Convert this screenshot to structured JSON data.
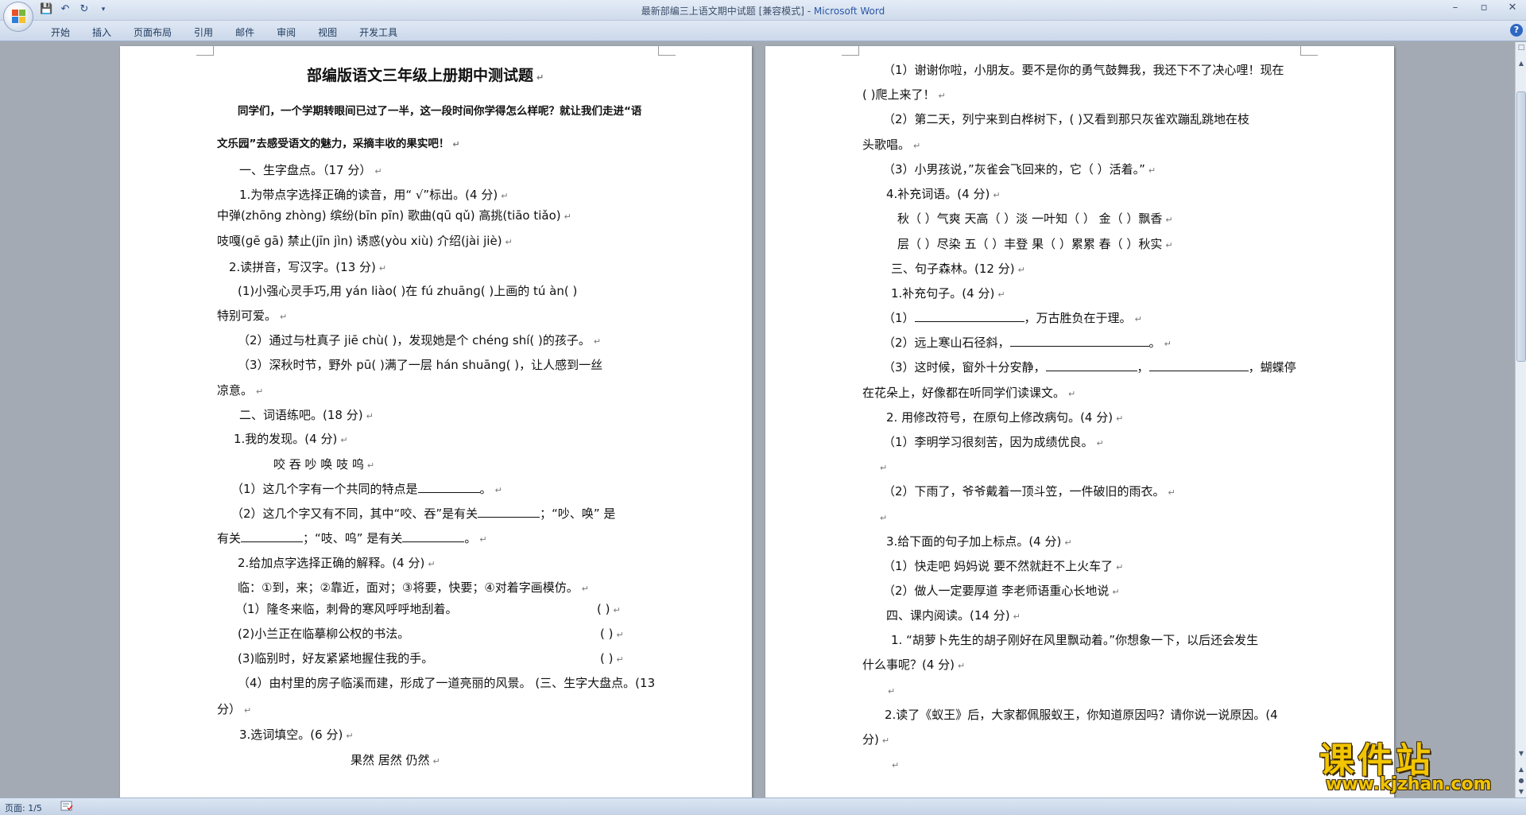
{
  "window": {
    "title": "最新部编三上语文期中试题 [兼容模式] - ",
    "app_name": "Microsoft Word",
    "controls": [
      "–",
      "▫",
      "✕"
    ]
  },
  "quick_access": [
    "save-icon",
    "undo-icon",
    "redo-icon",
    "customize-icon"
  ],
  "ribbon": {
    "tabs": [
      "开始",
      "插入",
      "页面布局",
      "引用",
      "邮件",
      "审阅",
      "视图",
      "开发工具"
    ]
  },
  "left_page": {
    "title": "部编版语文三年级上册期中测试题",
    "intro_1": "同学们，一个学期转眼间已过了一半，这一段时间你学得怎么样呢？就让我们走进“语",
    "intro_2": "文乐园”去感受语文的魅力，采摘丰收的果实吧！",
    "s1": "一、生字盘点。（17 分）",
    "q1": "1.为带点字选择正确的读音，用“ √”标出。(4 分)",
    "q1_row1": "中弹(zhōnɡ zhònɡ) 缤纷(bīn   pīn)  歌曲(qū   qǔ)    高挑(tiāo    tiǎo)",
    "q1_row2": "吱嘎(ɡē          ɡā)  禁止(jīn     jìn)  诱惑(yòu   xiù)  介绍(jài          jiè)",
    "q2": "2.读拼音，写汉字。(13 分)",
    "q2_1a": "(1)小强心灵手巧,用 yán   liào(      )在 fú  zhuānɡ(      )上画的 tú    àn(      )",
    "q2_1b": "特别可爱。",
    "q2_2": "（2）通过与杜真子 jiē    chù(        )，发现她是个 chénɡ    shí(        )的孩子。",
    "q2_3a": "（3）深秋时节，野外 pū(        )满了一层 hán    shuānɡ(        )，让人感到一丝",
    "q2_3b": "凉意。",
    "s2": "二、词语练吧。(18 分)",
    "w1": "1.我的发现。(4 分)",
    "w1_chars": "咬   吞   吵   唤   吱   呜",
    "w1_a": "（1）这几个字有一个共同的特点是",
    "w1_b1": "（2）这几个字又有不同，其中“咬、吞”是有关",
    "w1_b2": "；“吵、唤”  是",
    "w1_c1": "有关",
    "w1_c2": "；“吱、呜”  是有关",
    "w2": "2.给加点字选择正确的解释。(4 分)",
    "w2_def": "临：①到，来；②靠近，面对；③将要，快要；④对着字画模仿。",
    "w2_1": "（1）隆冬来临，刺骨的寒风呼呼地刮着。",
    "w2_2": "(2)小兰正在临摹柳公权的书法。",
    "w2_3": "(3)临别时，好友紧紧地握住我的手。",
    "w2_4a": "（4）由村里的房子临溪而建，形成了一道亮丽的风景。   (三、生字大盘点。(13",
    "w2_4b": "分）",
    "w3": "3.选词填空。(6 分)",
    "w3_words": "果然          居然          仍然",
    "paren": "(          )"
  },
  "right_page": {
    "r1a": "（1）谢谢你啦，小朋友。要不是你的勇气鼓舞我，我还下不了决心哩！现在",
    "r1b": "(       )爬上来了！",
    "r2a": "（2）第二天，列宁来到白桦树下，(        )又看到那只灰雀欢蹦乱跳地在枝",
    "r2b": "头歌唱。",
    "r3": "（3）小男孩说，”灰雀会飞回来的，它（          ）活着。”",
    "r4": "4.补充词语。(4 分)",
    "r4_row1": "秋（   ）气爽      天高（    ）淡     一叶知（    ）     金（    ）飘香",
    "r4_row2": "层（   ）尽染      五（    ）丰登     果（    ）累累     春（    ）秋实",
    "s3": "三、句子森林。(12 分)",
    "c1": "1.补充句子。(4 分)",
    "c1_1a": "（1）",
    "c1_1b": "，万古胜负在于理。",
    "c1_2a": "（2）远上寒山石径斜，",
    "c1_2b": "。",
    "c1_3a": "（3）这时候，窗外十分安静，",
    "c1_3b": "，",
    "c1_3c": "，蝴蝶停",
    "c1_3d": "在花朵上，好像都在听同学们读课文。",
    "c2": "2. 用修改符号，在原句上修改病句。(4 分)",
    "c2_1": "（1）李明学习很刻苦，因为成绩优良。",
    "c2_2": "（2）下雨了，爷爷戴着一顶斗笠，一件破旧的雨衣。",
    "c3": "3.给下面的句子加上标点。(4 分)",
    "c3_1": "（1）快走吧     妈妈说     要不然就赶不上火车了",
    "c3_2": "（2）做人一定要厚道        李老师语重心长地说",
    "s4": "四、课内阅读。(14 分)",
    "d1a": "1. “胡萝卜先生的胡子刚好在风里飘动着。”你想象一下，以后还会发生",
    "d1b": "什么事呢？(4 分)",
    "d2a": "2.读了《蚁王》后，大家都佩服蚁王，你知道原因吗？请你说一说原因。(4",
    "d2b": "分)"
  },
  "paragraph_mark": "↵",
  "status": {
    "page": "页面: 1/5"
  },
  "watermark": {
    "text": "课件站",
    "url": "www.kjzhan.com"
  },
  "colors": {
    "app_name": "#2a56a6",
    "workspace": "#a4aab3",
    "watermark": "#f2c500"
  }
}
